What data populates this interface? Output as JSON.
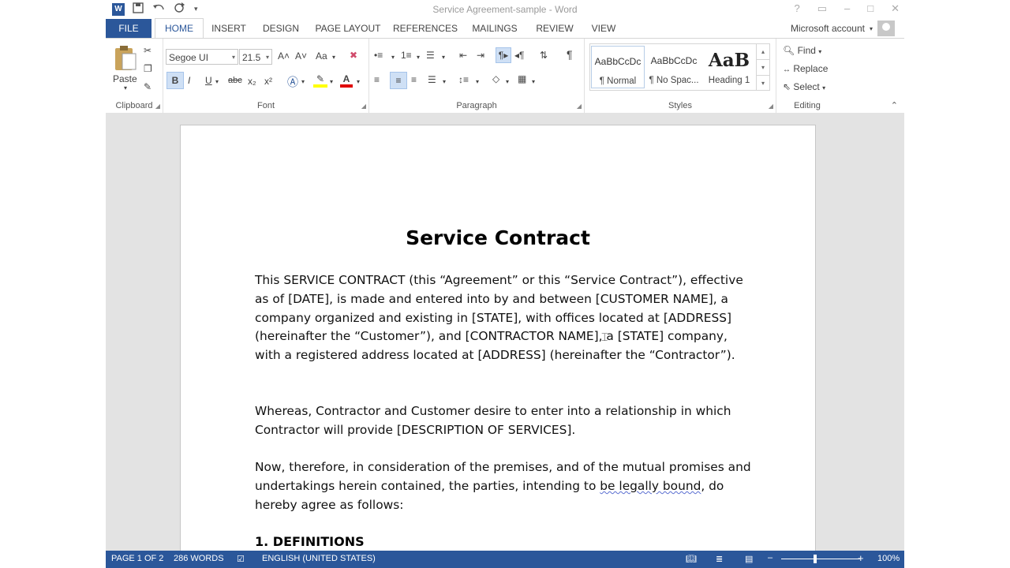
{
  "window": {
    "title": "Service Agreement-sample - Word"
  },
  "qat": {
    "icons": [
      "word-logo-icon",
      "save-icon",
      "undo-icon",
      "redo-icon",
      "customize-qat-icon"
    ],
    "logo_letter": "W"
  },
  "window_controls": {
    "help": "?",
    "ribbon_display": "▭",
    "minimize": "–",
    "restore": "□",
    "close": "✕"
  },
  "tabs": [
    {
      "label": "FILE"
    },
    {
      "label": "HOME"
    },
    {
      "label": "INSERT"
    },
    {
      "label": "DESIGN"
    },
    {
      "label": "PAGE LAYOUT"
    },
    {
      "label": "REFERENCES"
    },
    {
      "label": "MAILINGS"
    },
    {
      "label": "REVIEW"
    },
    {
      "label": "VIEW"
    }
  ],
  "account": {
    "label": "Microsoft account"
  },
  "ribbon": {
    "clipboard": {
      "label": "Clipboard",
      "paste": "Paste"
    },
    "font": {
      "label": "Font",
      "family": "Segoe UI",
      "size": "21.5",
      "bold": "B",
      "italic": "I",
      "underline": "U",
      "strike": "abc",
      "sub": "x₂",
      "sup": "x²",
      "grow": "A˄",
      "shrink": "A˅",
      "case": "Aa",
      "font_color_letter": "A"
    },
    "paragraph": {
      "label": "Paragraph",
      "pilcrow": "¶"
    },
    "styles": {
      "label": "Styles",
      "items": [
        {
          "sample": "AaBbCcDc",
          "name": "¶ Normal"
        },
        {
          "sample": "AaBbCcDc",
          "name": "¶ No Spac..."
        },
        {
          "sample": "AaB",
          "name": "Heading 1"
        }
      ]
    },
    "editing": {
      "label": "Editing",
      "find": "Find",
      "replace": "Replace",
      "select": "Select"
    }
  },
  "document": {
    "title": "Service Contract",
    "para1": "This SERVICE CONTRACT (this “Agreement” or this “Service Contract”), effective as of [DATE], is made and entered into by and between [CUSTOMER NAME], a company organized and existing in [STATE], with offices located at [ADDRESS] (hereinafter the “Customer”), and [CONTRACTOR NAME], a [STATE] company, with a registered address located at [ADDRESS] (hereinafter the “Contractor”).",
    "para2": "Whereas, Contractor and Customer desire to enter into a relationship in which Contractor will provide [DESCRIPTION OF SERVICES].",
    "para3_before": "Now, therefore, in consideration of the premises, and of the mutual promises and undertakings herein contained, the parties, intending to ",
    "para3_flag": "be legally bound",
    "para3_after": ", do hereby agree as follows:",
    "heading1": "1. DEFINITIONS"
  },
  "status": {
    "page": "PAGE 1 OF 2",
    "words": "286 WORDS",
    "language": "ENGLISH (UNITED STATES)",
    "zoom": "100%",
    "zoom_out": "–",
    "zoom_in": "+",
    "views": [
      "read-mode-icon",
      "print-layout-icon",
      "web-layout-icon"
    ]
  },
  "colors": {
    "accent": "#2b579a",
    "canvas": "#e3e3e3"
  }
}
